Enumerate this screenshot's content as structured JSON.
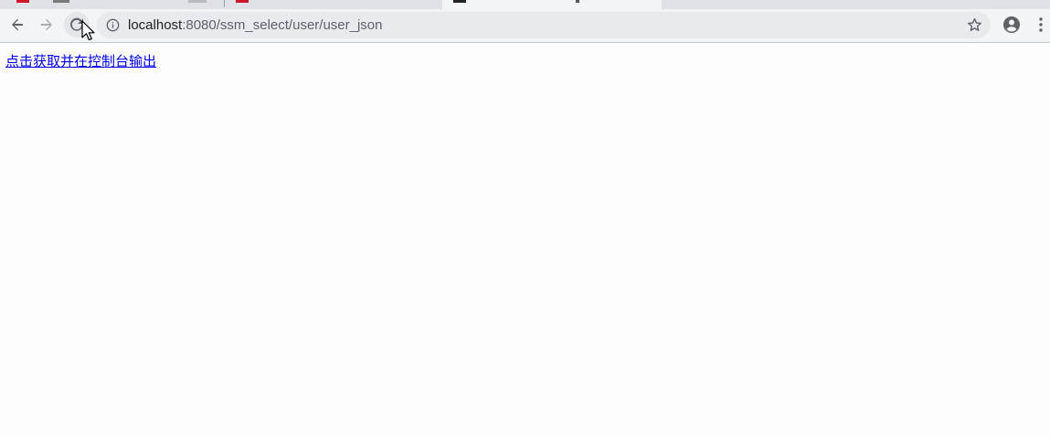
{
  "browser": {
    "address_bar": {
      "host": "localhost",
      "path": ":8080/ssm_select/user/user_json"
    }
  },
  "page": {
    "link_text": "点击获取并在控制台输出"
  },
  "colors": {
    "link": "#0000ee",
    "toolbar_bg": "#f3f4f6",
    "omnibox_bg": "#e9eaed",
    "icon": "#5f6368"
  }
}
